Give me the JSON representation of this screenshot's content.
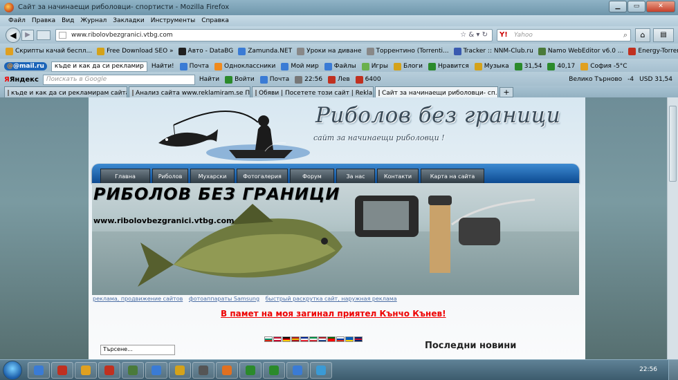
{
  "window": {
    "title": "Сайт за начинаещи риболовци- спортисти - Mozilla Firefox"
  },
  "menu": [
    "Файл",
    "Правка",
    "Вид",
    "Журнал",
    "Закладки",
    "Инструменты",
    "Справка"
  ],
  "nav": {
    "url": "www.ribolovbezgranici.vtbg.com",
    "search_placeholder": "Yahoo",
    "search_engine_icon": "yahoo-icon"
  },
  "bookmarks": [
    {
      "label": "Скрипты качай беспл...",
      "color": "#e0a020"
    },
    {
      "label": "Free Download SEO »",
      "color": "#d4a21a"
    },
    {
      "label": "Авто - DataBG",
      "color": "#202020"
    },
    {
      "label": "Zamunda.NET",
      "color": "#3a7bd5"
    },
    {
      "label": "Уроки на диване",
      "color": "#888888"
    },
    {
      "label": "Торрентино (Torrenti...",
      "color": "#888888"
    },
    {
      "label": "Tracker :: NNM-Club.ru",
      "color": "#3a5ab0"
    },
    {
      "label": "Namo WebEditor v6.0 ...",
      "color": "#4a7a3a"
    },
    {
      "label": "Energy-Torrent :: Tope...",
      "color": "#c03020"
    }
  ],
  "toolbar1": {
    "mailru": "@mail.ru",
    "query": "къде и как да си рекламир",
    "find": "Найти!",
    "items": [
      {
        "label": "Почта",
        "color": "#3a7bd5"
      },
      {
        "label": "Одноклассники",
        "color": "#f08a1c"
      },
      {
        "label": "Мой мир",
        "color": "#3a7bd5"
      },
      {
        "label": "Файлы",
        "color": "#3a7bd5"
      },
      {
        "label": "Игры",
        "color": "#6ab04c"
      },
      {
        "label": "Блоги",
        "color": "#d4a21a"
      },
      {
        "label": "Нравится",
        "color": "#2b8a2b"
      },
      {
        "label": "Музыка",
        "color": "#d4a21a"
      },
      {
        "label": "31,54",
        "color": "#2b8a2b"
      },
      {
        "label": "40,17",
        "color": "#2b8a2b"
      },
      {
        "label": "София -5°C",
        "color": "#e0a020"
      }
    ]
  },
  "toolbar2": {
    "yandex": "Яндекс",
    "search_placeholder": "Поискать в Google",
    "find": "Найти",
    "items": [
      {
        "label": "Войти",
        "color": "#2b8a2b"
      },
      {
        "label": "Почта",
        "color": "#3a7bd5"
      },
      {
        "label": "22:56",
        "color": "#777777"
      },
      {
        "label": "Лев",
        "color": "#c03020"
      },
      {
        "label": "6400",
        "color": "#c03020"
      }
    ],
    "right_items": [
      "Велико Търново",
      "-4",
      "USD 31,54"
    ]
  },
  "tabs": [
    {
      "label": "къде и как да си рекламирам сайта ...",
      "active": false
    },
    {
      "label": "Анализ сайта www.reklamiram.se П...",
      "active": false
    },
    {
      "label": "Обяви | Посетете този сайт | Reklam...",
      "active": false
    },
    {
      "label": "Сайт за начинаещи риболовци- сп...",
      "active": true
    }
  ],
  "site": {
    "title": "Риболов без граници",
    "subtitle": "сайт за начинаещи риболовци !",
    "menu": [
      "Главна",
      "Риболов",
      "Мухарски",
      "Фотогалерия",
      "Форум",
      "За нас",
      "Контакти",
      "Карта на сайта"
    ],
    "banner_title": "РИБОЛОВ БЕЗ ГРАНИЦИ",
    "banner_url": "www.ribolovbezgranici.vtbg.com",
    "ad_links": [
      "реклама, продвижение сайтов",
      "фотоаппараты Samsung",
      "быстрый раскрутка сайт, наружная реклама"
    ],
    "memorial": "В памет на моя загинал приятел Кънчо Кънев!",
    "search_value": "Търсене...",
    "latest_news": "Последни новини",
    "flags": [
      [
        "#ffffff",
        "#00966e",
        "#d62612"
      ],
      [
        "#c60c30",
        "#ffffff",
        "#c60c30"
      ],
      [
        "#000000",
        "#dd0000",
        "#ffce00"
      ],
      [
        "#aa151b",
        "#f1bf00",
        "#aa151b"
      ],
      [
        "#002395",
        "#ffffff",
        "#ed2939"
      ],
      [
        "#009246",
        "#ffffff",
        "#ce2b37"
      ],
      [
        "#ae1c28",
        "#ffffff",
        "#21468b"
      ],
      [
        "#006600",
        "#ff0000",
        "#ff0000"
      ],
      [
        "#ffffff",
        "#0039a6",
        "#d52b1e"
      ],
      [
        "#005bbb",
        "#005bbb",
        "#ffd500"
      ],
      [
        "#012169",
        "#c8102e",
        "#012169"
      ]
    ]
  },
  "taskbar": {
    "clock": "22:56",
    "apps": [
      "#3a7bd5",
      "#c03020",
      "#e0a020",
      "#c03020",
      "#4a7a3a",
      "#3a7bd5",
      "#d4a21a",
      "#555555",
      "#e07020",
      "#2b8a2b",
      "#2b8a2b",
      "#3a7bd5",
      "#3a9ad5"
    ]
  }
}
